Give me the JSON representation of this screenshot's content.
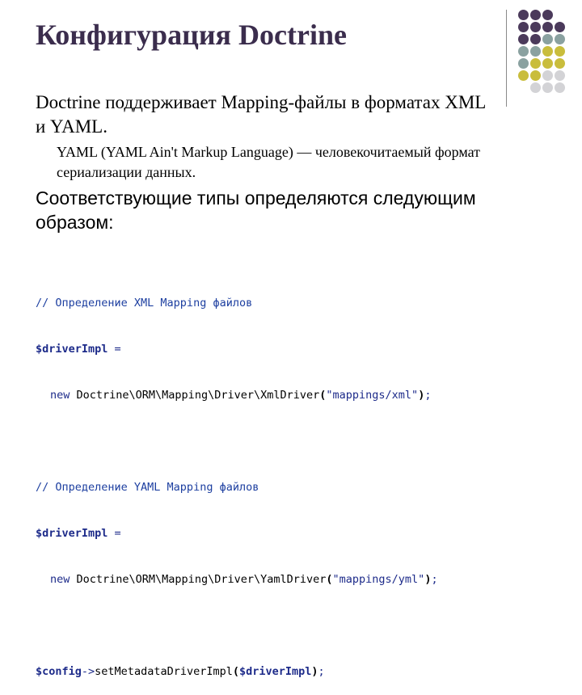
{
  "slide": {
    "title": "Конфигурация Doctrine",
    "paragraph1": "Doctrine поддерживает Mapping-файлы в форматах XML и YAML.",
    "paragraph2": "YAML (YAML Ain't Markup Language) — человекочитаемый формат сериализации данных.",
    "paragraph3": "Соответствующие типы определяются следующим образом:"
  },
  "code": {
    "comment1": "// Определение XML Mapping файлов",
    "var": "$driverImpl",
    "assign": " =",
    "new_kw": "new ",
    "xml_class": "Doctrine\\ORM\\Mapping\\Driver\\XmlDriver",
    "open_paren": "(",
    "xml_arg": "\"mappings/xml\"",
    "close_paren": ")",
    "semicolon": ";",
    "comment2": "// Определение YAML Mapping файлов",
    "yaml_class": "Doctrine\\ORM\\Mapping\\Driver\\YamlDriver",
    "yaml_arg": "\"mappings/yml\"",
    "config_var": "$config",
    "arrow": "->",
    "method": "setMetadataDriverImpl"
  },
  "decoration": {
    "colors": {
      "purple": "#4b3a5b",
      "teal": "#8aa1a0",
      "olive": "#c9bd3c",
      "grey": "#d3d3d6",
      "line": "#8a8a8a"
    },
    "dot_grid": [
      [
        "purple",
        "purple",
        "purple",
        null
      ],
      [
        "purple",
        "purple",
        "purple",
        "purple"
      ],
      [
        "purple",
        "purple",
        "teal",
        "teal"
      ],
      [
        "teal",
        "teal",
        "olive",
        "olive"
      ],
      [
        "teal",
        "olive",
        "olive",
        "olive"
      ],
      [
        "olive",
        "olive",
        "grey",
        "grey"
      ],
      [
        null,
        "grey",
        "grey",
        "grey"
      ]
    ]
  }
}
